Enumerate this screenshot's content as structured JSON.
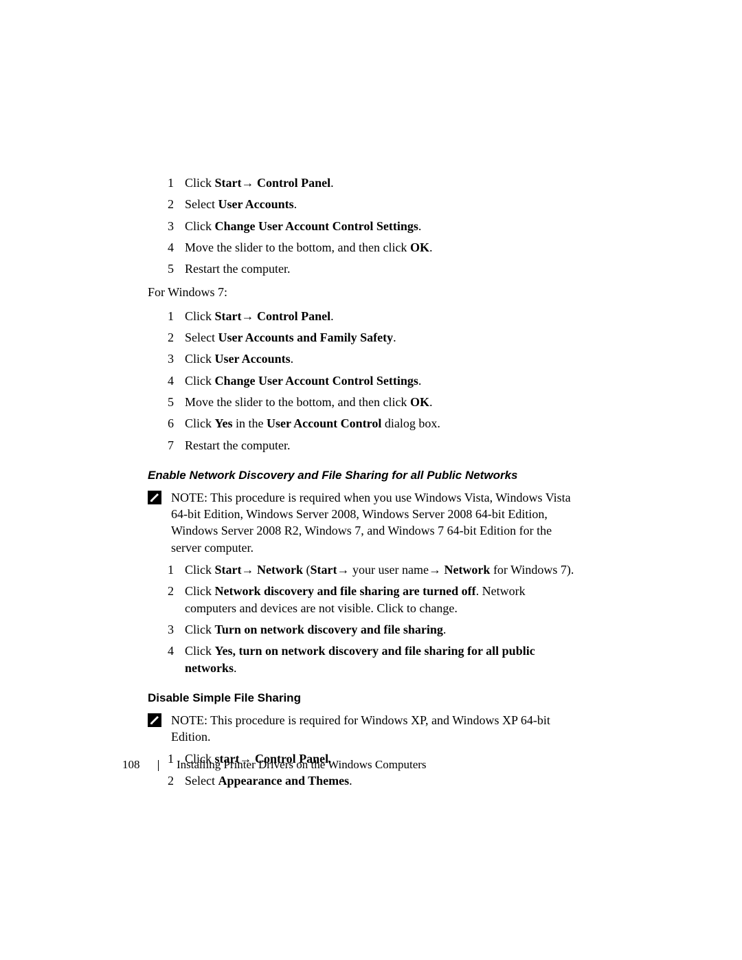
{
  "list1": {
    "items": [
      {
        "n": "1",
        "html": "Click <b>Start</b><span class='arrow'>→</span> <b>Control Panel</b>."
      },
      {
        "n": "2",
        "html": "Select <b>User Accounts</b>."
      },
      {
        "n": "3",
        "html": "Click <b>Change User Account Control Settings</b>."
      },
      {
        "n": "4",
        "html": "Move the slider to the bottom, and then click <b>OK</b>."
      },
      {
        "n": "5",
        "html": "Restart the computer."
      }
    ]
  },
  "para_win7": "For Windows 7:",
  "list2": {
    "items": [
      {
        "n": "1",
        "html": "Click <b>Start</b><span class='arrow'>→</span> <b>Control Panel</b>."
      },
      {
        "n": "2",
        "html": "Select <b>User Accounts and Family Safety</b>."
      },
      {
        "n": "3",
        "html": "Click <b>User Accounts</b>."
      },
      {
        "n": "4",
        "html": "Click <b>Change User Account Control Settings</b>."
      },
      {
        "n": "5",
        "html": "Move the slider to the bottom, and then click <b>OK</b>."
      },
      {
        "n": "6",
        "html": "Click <b>Yes</b> in the <b>User Account Control</b> dialog box."
      },
      {
        "n": "7",
        "html": "Restart the computer."
      }
    ]
  },
  "heading_enable": "Enable Network Discovery and File Sharing for all Public Networks",
  "note1": "NOTE: This procedure is required when you use Windows Vista, Windows Vista 64-bit Edition, Windows Server 2008, Windows Server 2008 64-bit Edition, Windows Server 2008 R2, Windows 7, and Windows 7 64-bit Edition for the server computer.",
  "list3": {
    "items": [
      {
        "n": "1",
        "html": "Click <b>Start</b><span class='arrow'>→</span> <b>Network</b> (<b>Start</b><span class='arrow'>→</span> your user name<span class='arrow'>→</span> <b>Network</b> for Windows 7)."
      },
      {
        "n": "2",
        "html": "Click <b>Network discovery and file sharing are turned off</b>. Network computers and devices are not visible. Click to change."
      },
      {
        "n": "3",
        "html": "Click <b>Turn on network discovery and file sharing</b>."
      },
      {
        "n": "4",
        "html": "Click <b>Yes, turn on network discovery and file sharing for all public networks</b>."
      }
    ]
  },
  "heading_disable": "Disable Simple File Sharing",
  "note2": "NOTE: This procedure is required for Windows XP, and Windows XP 64-bit Edition.",
  "list4": {
    "items": [
      {
        "n": "1",
        "html": "Click <b>start</b><span class='arrow'>→</span> <b>Control Panel</b>."
      },
      {
        "n": "2",
        "html": "Select <b>Appearance and Themes</b>."
      }
    ]
  },
  "footer": {
    "pageno": "108",
    "title": "Installing Printer Drivers on the Windows Computers"
  }
}
